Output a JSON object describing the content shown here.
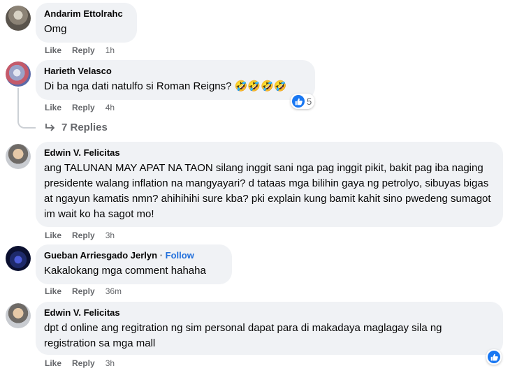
{
  "comments": [
    {
      "author": "Andarim Ettolrahc",
      "text": "Omg",
      "like": "Like",
      "reply": "Reply",
      "time": "1h"
    },
    {
      "author": "Harieth Velasco",
      "text": "Di ba nga dati natulfo si Roman Reigns? 🤣🤣🤣🤣",
      "like": "Like",
      "reply": "Reply",
      "time": "4h",
      "reaction_count": "5"
    },
    {
      "author": "Edwin V. Felicitas",
      "text": "ang TALUNAN MAY APAT NA TAON silang inggit sani nga pag inggit pikit, bakit pag iba naging presidente walang inflation na mangyayari? d tataas mga bilihin gaya ng petrolyo, sibuyas bigas at ngayun kamatis nmn? ahihihihi sure kba? pki explain kung bamit kahit sino pwedeng sumagot im wait ko ha sagot mo!",
      "like": "Like",
      "reply": "Reply",
      "time": "3h"
    },
    {
      "author": "Gueban Arriesgado Jerlyn",
      "separator": "·",
      "follow": "Follow",
      "text": "Kakalokang mga comment hahaha",
      "like": "Like",
      "reply": "Reply",
      "time": "36m"
    },
    {
      "author": "Edwin V. Felicitas",
      "text": "dpt d online ang regitration ng sim personal dapat para di makadaya maglagay sila ng registration sa mga mall",
      "like": "Like",
      "reply": "Reply",
      "time": "3h"
    }
  ],
  "replies_link": "7 Replies",
  "icons": {
    "reply_arrow": "reply-arrow-icon",
    "like": "like-thumb-icon"
  },
  "colors": {
    "bubble": "#f0f2f5",
    "secondary_text": "#65676b",
    "link": "#216fdb",
    "like_blue": "#1877f2"
  }
}
